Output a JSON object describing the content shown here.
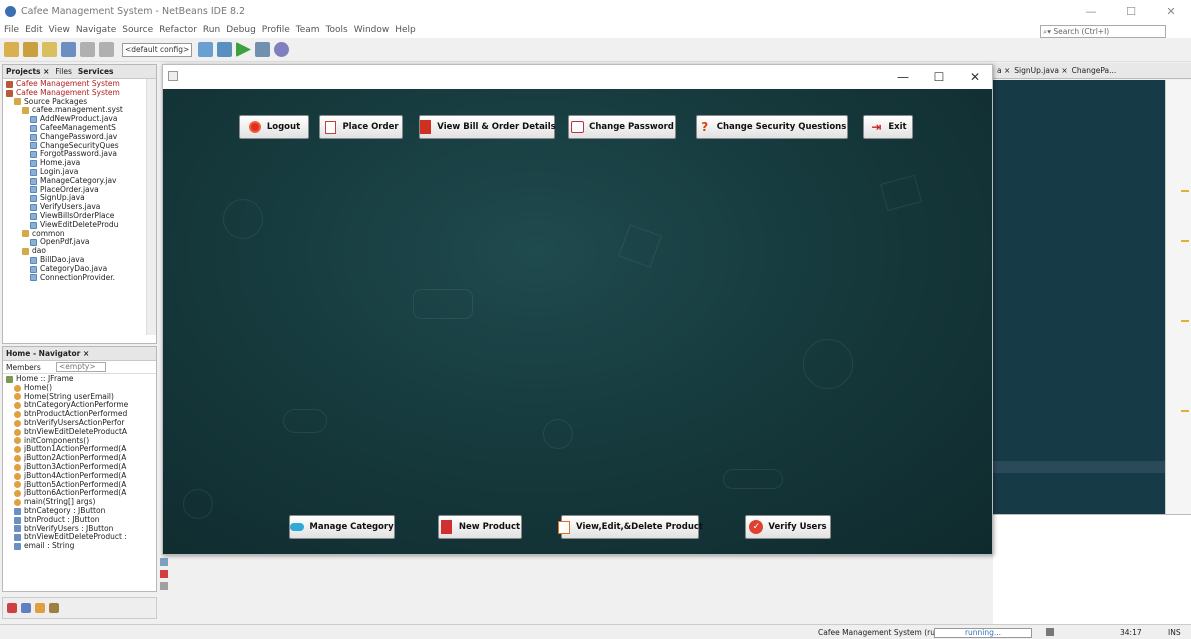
{
  "window": {
    "title": "Cafee Management System - NetBeans IDE 8.2",
    "minimize": "—",
    "maximize": "☐",
    "close": "✕"
  },
  "menu": [
    "File",
    "Edit",
    "View",
    "Navigate",
    "Source",
    "Refactor",
    "Run",
    "Debug",
    "Profile",
    "Team",
    "Tools",
    "Window",
    "Help"
  ],
  "search_placeholder": "Search (Ctrl+I)",
  "toolbar": {
    "config": "<default config>"
  },
  "projects_panel": {
    "tabs": [
      "Projects ×",
      "Files",
      "Services"
    ],
    "items": [
      {
        "label": "Cafee Management System",
        "icon": "proj",
        "indent": 0,
        "color": "#b02020"
      },
      {
        "label": "Cafee Management System",
        "icon": "proj",
        "indent": 0,
        "color": "#b02020"
      },
      {
        "label": "Source Packages",
        "icon": "pkg",
        "indent": 1
      },
      {
        "label": "cafee.management.syst",
        "icon": "pkg",
        "indent": 2
      },
      {
        "label": "AddNewProduct.java",
        "icon": "java",
        "indent": 3
      },
      {
        "label": "CafeeManagementS",
        "icon": "java",
        "indent": 3
      },
      {
        "label": "ChangePassword.jav",
        "icon": "java",
        "indent": 3
      },
      {
        "label": "ChangeSecurityQues",
        "icon": "java",
        "indent": 3
      },
      {
        "label": "ForgotPassword.java",
        "icon": "java",
        "indent": 3
      },
      {
        "label": "Home.java",
        "icon": "java",
        "indent": 3
      },
      {
        "label": "Login.java",
        "icon": "java",
        "indent": 3
      },
      {
        "label": "ManageCategory.jav",
        "icon": "java",
        "indent": 3
      },
      {
        "label": "PlaceOrder.java",
        "icon": "java",
        "indent": 3
      },
      {
        "label": "SignUp.java",
        "icon": "java",
        "indent": 3
      },
      {
        "label": "VerifyUsers.java",
        "icon": "java",
        "indent": 3
      },
      {
        "label": "ViewBillsOrderPlace",
        "icon": "java",
        "indent": 3
      },
      {
        "label": "ViewEditDeleteProdu",
        "icon": "java",
        "indent": 3
      },
      {
        "label": "common",
        "icon": "pkg",
        "indent": 2
      },
      {
        "label": "OpenPdf.java",
        "icon": "java",
        "indent": 3
      },
      {
        "label": "dao",
        "icon": "pkg",
        "indent": 2
      },
      {
        "label": "BillDao.java",
        "icon": "java",
        "indent": 3
      },
      {
        "label": "CategoryDao.java",
        "icon": "java",
        "indent": 3
      },
      {
        "label": "ConnectionProvider.",
        "icon": "java",
        "indent": 3
      }
    ]
  },
  "navigator_panel": {
    "title": "Home - Navigator ×",
    "members_label": "Members",
    "filter": "<empty>",
    "items": [
      {
        "label": "Home :: JFrame",
        "icon": "frame",
        "indent": 0
      },
      {
        "label": "Home()",
        "icon": "method",
        "indent": 1
      },
      {
        "label": "Home(String userEmail)",
        "icon": "method",
        "indent": 1
      },
      {
        "label": "btnCategoryActionPerforme",
        "icon": "method",
        "indent": 1
      },
      {
        "label": "btnProductActionPerformed",
        "icon": "method",
        "indent": 1
      },
      {
        "label": "btnVerifyUsersActionPerfor",
        "icon": "method",
        "indent": 1
      },
      {
        "label": "btnViewEditDeleteProductA",
        "icon": "method",
        "indent": 1
      },
      {
        "label": "initComponents()",
        "icon": "method",
        "indent": 1
      },
      {
        "label": "jButton1ActionPerformed(A",
        "icon": "method",
        "indent": 1
      },
      {
        "label": "jButton2ActionPerformed(A",
        "icon": "method",
        "indent": 1
      },
      {
        "label": "jButton3ActionPerformed(A",
        "icon": "method",
        "indent": 1
      },
      {
        "label": "jButton4ActionPerformed(A",
        "icon": "method",
        "indent": 1
      },
      {
        "label": "jButton5ActionPerformed(A",
        "icon": "method",
        "indent": 1
      },
      {
        "label": "jButton6ActionPerformed(A",
        "icon": "method",
        "indent": 1
      },
      {
        "label": "main(String[] args)",
        "icon": "method",
        "indent": 1
      },
      {
        "label": "btnCategory : JButton",
        "icon": "field",
        "indent": 1
      },
      {
        "label": "btnProduct : JButton",
        "icon": "field",
        "indent": 1
      },
      {
        "label": "btnVerifyUsers : JButton",
        "icon": "field",
        "indent": 1
      },
      {
        "label": "btnViewEditDeleteProduct :",
        "icon": "field",
        "indent": 1
      },
      {
        "label": "email : String",
        "icon": "field",
        "indent": 1
      }
    ]
  },
  "editor_tabs": [
    "a ×",
    "SignUp.java ×",
    "ChangePa..."
  ],
  "app": {
    "top_buttons": [
      {
        "label": "Logout",
        "icon": "logout-icon",
        "color": "#e03020"
      },
      {
        "label": "Place Order",
        "icon": "order-icon",
        "color": "#c04040"
      },
      {
        "label": "View Bill & Order Details",
        "icon": "bill-icon",
        "color": "#d03020"
      },
      {
        "label": "Change Password",
        "icon": "password-icon",
        "color": "#c03040"
      },
      {
        "label": "Change Security Questions",
        "icon": "question-icon",
        "color": "#e04010"
      },
      {
        "label": "Exit",
        "icon": "exit-icon",
        "color": "#d02020"
      }
    ],
    "bottom_buttons": [
      {
        "label": "Manage Category",
        "icon": "category-icon",
        "color": "#30a8d8"
      },
      {
        "label": "New Product",
        "icon": "product-icon",
        "color": "#d03030"
      },
      {
        "label": "View,Edit,&Delete Product",
        "icon": "edit-icon",
        "color": "#e07020"
      },
      {
        "label": "Verify Users",
        "icon": "verify-icon",
        "color": "#e04030"
      }
    ]
  },
  "status": {
    "run_label": "Cafee Management System (run)",
    "progress_text": "running...",
    "position": "34:17",
    "mode": "INS"
  }
}
